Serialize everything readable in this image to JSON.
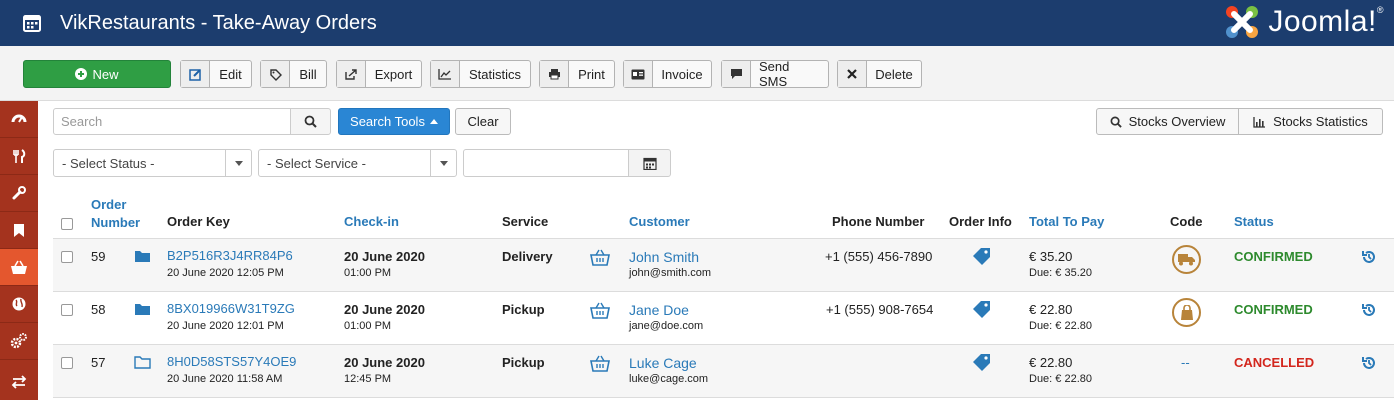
{
  "header": {
    "title": "VikRestaurants - Take-Away Orders",
    "logo_text": "Joomla!",
    "logo_mark": "®"
  },
  "toolbar": {
    "new_label": "New",
    "edit_label": "Edit",
    "bill_label": "Bill",
    "export_label": "Export",
    "statistics_label": "Statistics",
    "print_label": "Print",
    "invoice_label": "Invoice",
    "sms_label": "Send SMS",
    "delete_label": "Delete"
  },
  "filters": {
    "search_placeholder": "Search",
    "search_tools_label": "Search Tools",
    "clear_label": "Clear",
    "stocks_overview_label": "Stocks Overview",
    "stocks_statistics_label": "Stocks Statistics",
    "status_select": "- Select Status -",
    "service_select": "- Select Service -"
  },
  "table": {
    "headers": {
      "order_number_1": "Order",
      "order_number_2": "Number",
      "order_key": "Order Key",
      "checkin": "Check-in",
      "service": "Service",
      "customer": "Customer",
      "phone": "Phone Number",
      "order_info": "Order Info",
      "total": "Total To Pay",
      "code": "Code",
      "status": "Status"
    },
    "rows": [
      {
        "number": "59",
        "key": "B2P516R3J4RR84P6",
        "created": "20 June 2020 12:05 PM",
        "checkin_date": "20 June 2020",
        "checkin_time": "01:00 PM",
        "service": "Delivery",
        "customer_name": "John Smith",
        "customer_email": "john@smith.com",
        "phone": "+1 (555) 456-7890",
        "total": "€ 35.20",
        "due": "Due: € 35.20",
        "code": "",
        "status": "CONFIRMED"
      },
      {
        "number": "58",
        "key": "8BX019966W31T9ZG",
        "created": "20 June 2020 12:01 PM",
        "checkin_date": "20 June 2020",
        "checkin_time": "01:00 PM",
        "service": "Pickup",
        "customer_name": "Jane Doe",
        "customer_email": "jane@doe.com",
        "phone": "+1 (555) 908-7654",
        "total": "€ 22.80",
        "due": "Due: € 22.80",
        "code": "",
        "status": "CONFIRMED"
      },
      {
        "number": "57",
        "key": "8H0D58STS57Y4OE9",
        "created": "20 June 2020 11:58 AM",
        "checkin_date": "20 June 2020",
        "checkin_time": "12:45 PM",
        "service": "Pickup",
        "customer_name": "Luke Cage",
        "customer_email": "luke@cage.com",
        "phone": "",
        "total": "€ 22.80",
        "due": "Due: € 22.80",
        "code": "--",
        "status": "CANCELLED"
      }
    ]
  },
  "icons": {
    "sidebar": [
      "dashboard-icon",
      "restaurant-icon",
      "wrench-icon",
      "bookmark-icon",
      "basket-icon",
      "globe-icon",
      "cogs-icon",
      "transfer-icon"
    ],
    "code": [
      "delivery-truck-icon",
      "takeaway-bag-icon"
    ]
  },
  "colors": {
    "header": "#1c3d6e",
    "sidebar": "#a4331e",
    "sidebar_active": "#e4572e",
    "new_button": "#2f9e44",
    "search_tools": "#2a86d4",
    "confirmed": "#2d8a2d",
    "cancelled": "#d3261d",
    "link": "#2a7ab8",
    "code_badge": "#b8843a"
  }
}
